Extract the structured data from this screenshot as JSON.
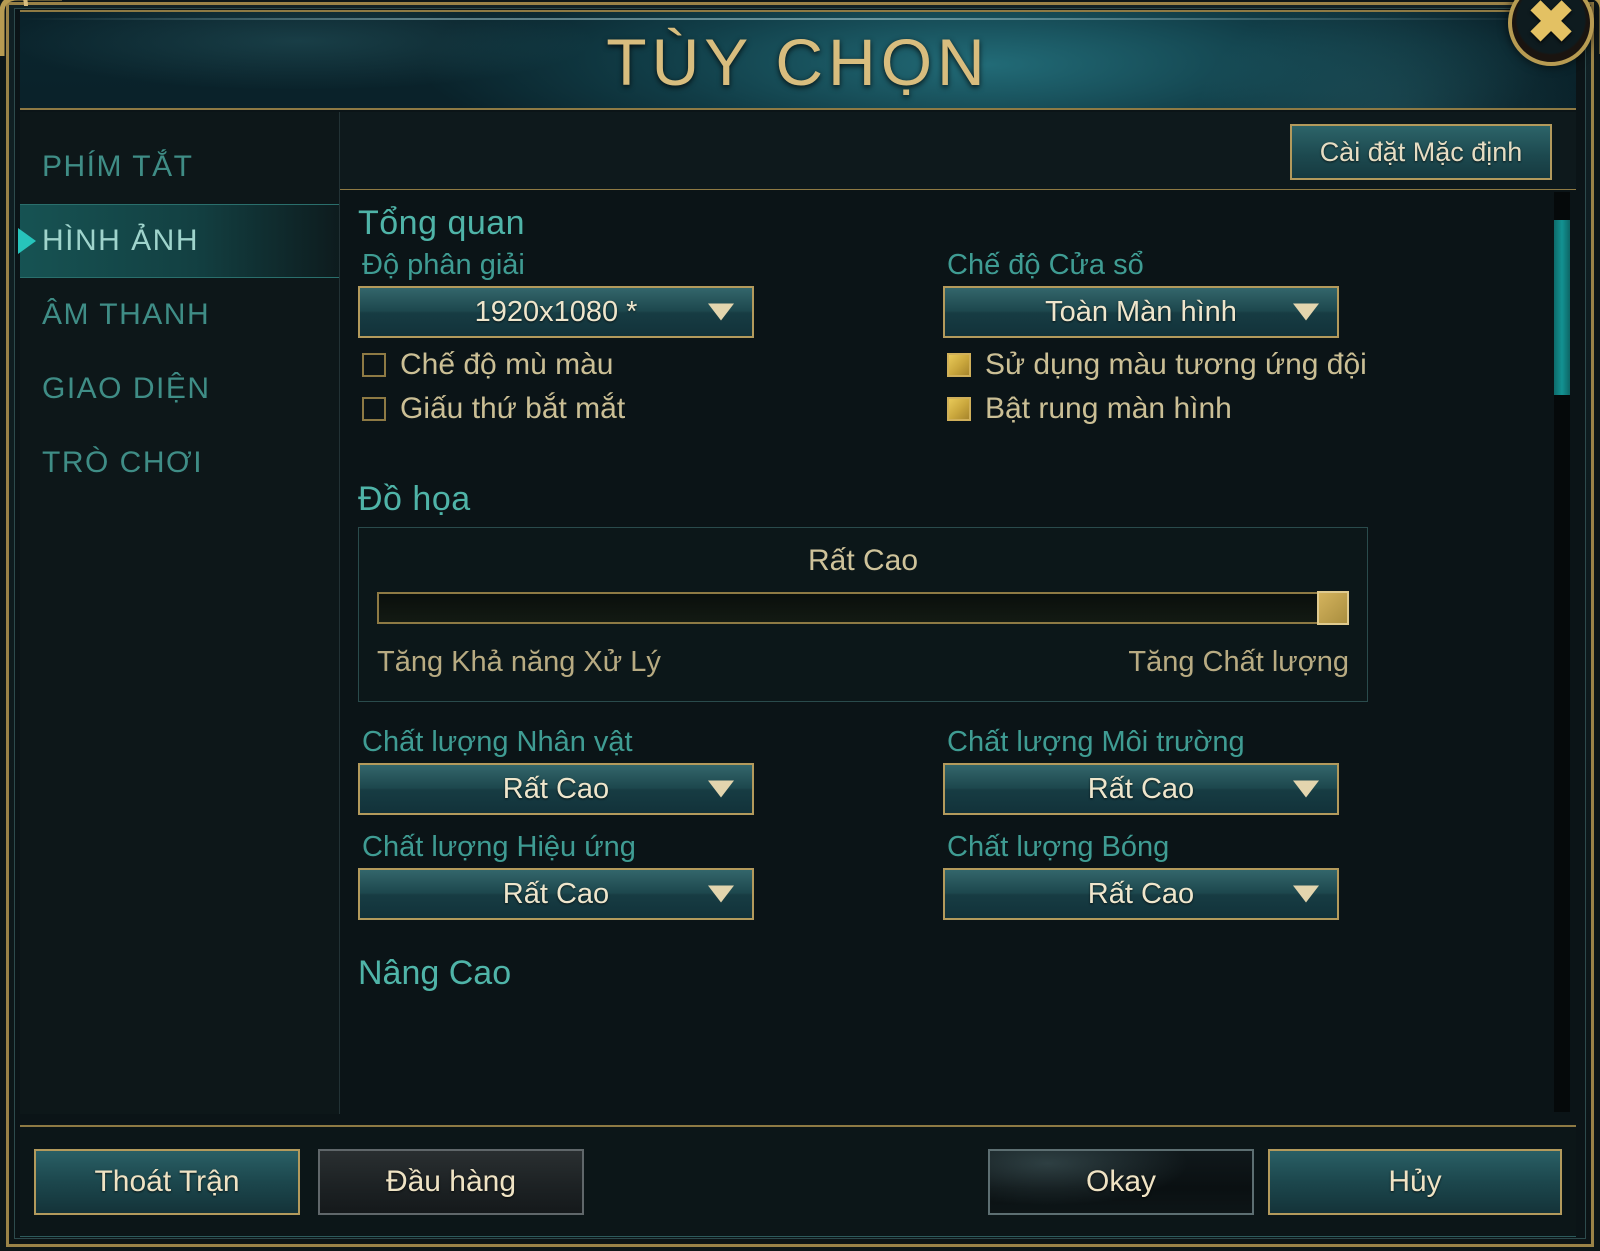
{
  "window": {
    "title": "TÙY CHỌN",
    "close_icon": "close-icon"
  },
  "sidebar": {
    "items": [
      {
        "label": "PHÍM TẮT",
        "active": false
      },
      {
        "label": "HÌNH ẢNH",
        "active": true
      },
      {
        "label": "ÂM THANH",
        "active": false
      },
      {
        "label": "GIAO DIỆN",
        "active": false
      },
      {
        "label": "TRÒ CHƠI",
        "active": false
      }
    ]
  },
  "content_header": {
    "default_button": "Cài đặt Mặc định"
  },
  "sections": {
    "overview": {
      "title": "Tổng quan",
      "resolution": {
        "label": "Độ phân giải",
        "value": "1920x1080 *",
        "caret_icon": "chevron-down-icon"
      },
      "window_mode": {
        "label": "Chế độ Cửa sổ",
        "value": "Toàn Màn hình",
        "caret_icon": "chevron-down-icon"
      },
      "checkboxes_left": [
        {
          "label": "Chế độ mù màu",
          "checked": false
        },
        {
          "label": "Giấu thứ bắt mắt",
          "checked": false
        }
      ],
      "checkboxes_right": [
        {
          "label": "Sử dụng màu tương ứng đội",
          "checked": true
        },
        {
          "label": "Bật rung màn hình",
          "checked": true
        }
      ]
    },
    "graphics": {
      "title": "Đồ họa",
      "slider": {
        "value_label": "Rất Cao",
        "left_label": "Tăng Khả năng Xử Lý",
        "right_label": "Tăng Chất lượng",
        "percent": 100
      },
      "quality": [
        {
          "label": "Chất lượng Nhân vật",
          "value": "Rất Cao",
          "caret_icon": "chevron-down-icon"
        },
        {
          "label": "Chất lượng Môi trường",
          "value": "Rất Cao",
          "caret_icon": "chevron-down-icon"
        },
        {
          "label": "Chất lượng Hiệu ứng",
          "value": "Rất Cao",
          "caret_icon": "chevron-down-icon"
        },
        {
          "label": "Chất lượng Bóng",
          "value": "Rất Cao",
          "caret_icon": "chevron-down-icon"
        }
      ]
    },
    "advanced": {
      "title": "Nâng Cao"
    }
  },
  "footer": {
    "exit_match": "Thoát Trận",
    "surrender": "Đầu hàng",
    "okay": "Okay",
    "cancel": "Hủy"
  },
  "colors": {
    "gold": "#b39a5c",
    "teal_accent": "#4fb4a8",
    "title_gold": "#d8bd7e",
    "checkbox_on": "#c9a63c",
    "scrollbar_thumb": "#139292"
  }
}
